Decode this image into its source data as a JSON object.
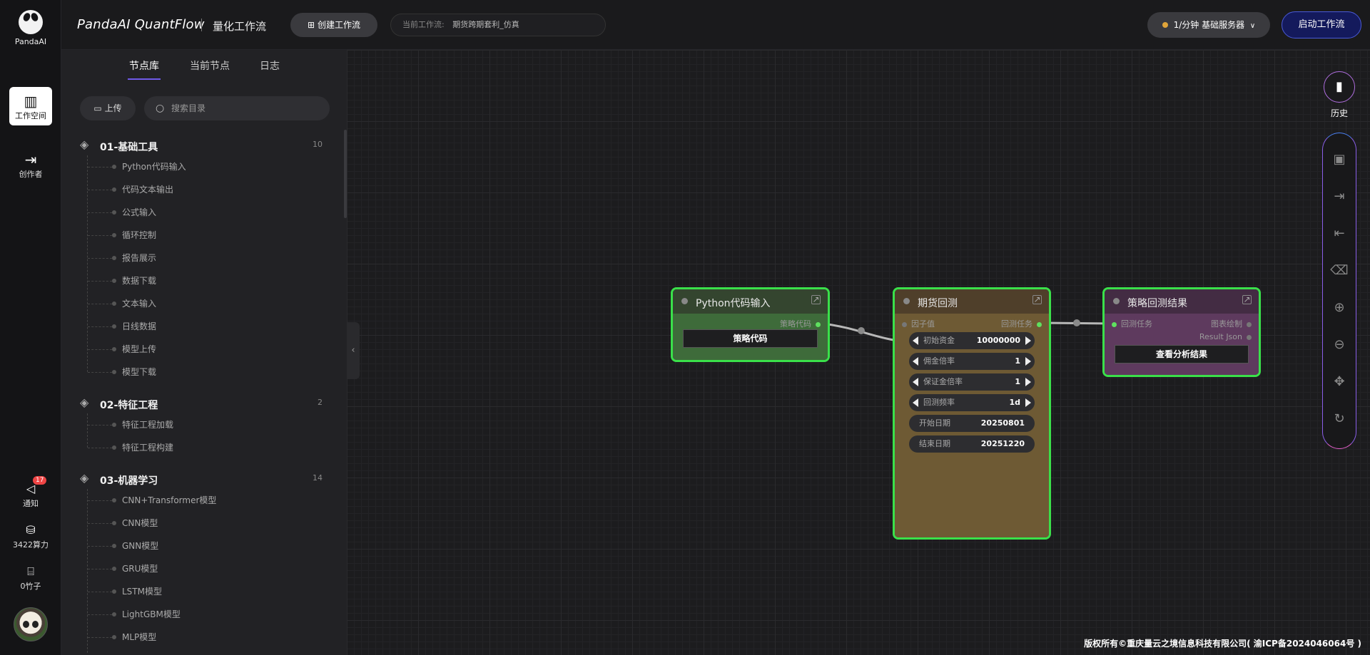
{
  "app": {
    "logo_text": "PandaAI",
    "brand": "PandaAI QuantFlow",
    "brand_sub": "量化工作流"
  },
  "rail": [
    {
      "label": "工作空间",
      "icon": "layout-icon"
    },
    {
      "label": "创作者",
      "icon": "exit-icon"
    },
    {
      "label": "通知",
      "icon": "megaphone-icon",
      "badge": "17"
    },
    {
      "label": "3422算力",
      "icon": "database-icon"
    },
    {
      "label": "0竹子",
      "icon": "bamboo-icon"
    }
  ],
  "toolbar": {
    "create_label": "创建工作流",
    "current_flow_label": "当前工作流:",
    "current_flow_value": "期货跨期套利_仿真",
    "server_label": "1/分钟  基础服务器",
    "run_label": "启动工作流"
  },
  "panel": {
    "tabs": [
      "节点库",
      "当前节点",
      "日志"
    ],
    "upload_label": "上传",
    "search_placeholder": "搜索目录",
    "groups": [
      {
        "name": "01-基础工具",
        "count": "10",
        "items": [
          "Python代码输入",
          "代码文本输出",
          "公式输入",
          "循环控制",
          "报告展示",
          "数据下载",
          "文本输入",
          "日线数据",
          "模型上传",
          "模型下载"
        ]
      },
      {
        "name": "02-特征工程",
        "count": "2",
        "items": [
          "特征工程加载",
          "特征工程构建"
        ]
      },
      {
        "name": "03-机器学习",
        "count": "14",
        "items": [
          "CNN+Transformer模型",
          "CNN模型",
          "GNN模型",
          "GRU模型",
          "LSTM模型",
          "LightGBM模型",
          "MLP模型"
        ]
      }
    ]
  },
  "nodes": {
    "python": {
      "title": "Python代码输入",
      "out_port": "策略代码",
      "button": "策略代码",
      "color": "#3e6b3a"
    },
    "backtest": {
      "title": "期货回测",
      "in_port": "因子值",
      "out_port": "回测任务",
      "color": "#6e5a34",
      "fields": [
        {
          "label": "初始资金",
          "value": "10000000",
          "stepper": true
        },
        {
          "label": "佣金倍率",
          "value": "1",
          "stepper": true
        },
        {
          "label": "保证金倍率",
          "value": "1",
          "stepper": true
        },
        {
          "label": "回测频率",
          "value": "1d",
          "stepper": true
        },
        {
          "label": "开始日期",
          "value": "20250801",
          "stepper": false
        },
        {
          "label": "结束日期",
          "value": "20251220",
          "stepper": false
        }
      ]
    },
    "result": {
      "title": "策略回测结果",
      "in_port": "回测任务",
      "out_port_1": "图表绘制",
      "out_port_2": "Result Json",
      "button": "查看分析结果",
      "color": "#5e3a5e"
    }
  },
  "history_label": "历史",
  "tools": [
    "save-icon",
    "export-icon",
    "import-icon",
    "trash-icon",
    "zoom-in-icon",
    "zoom-out-icon",
    "fit-view-icon",
    "reset-icon"
  ],
  "footer": "版权所有©重庆量云之境信息科技有限公司( 渝ICP备2024046064号 )"
}
